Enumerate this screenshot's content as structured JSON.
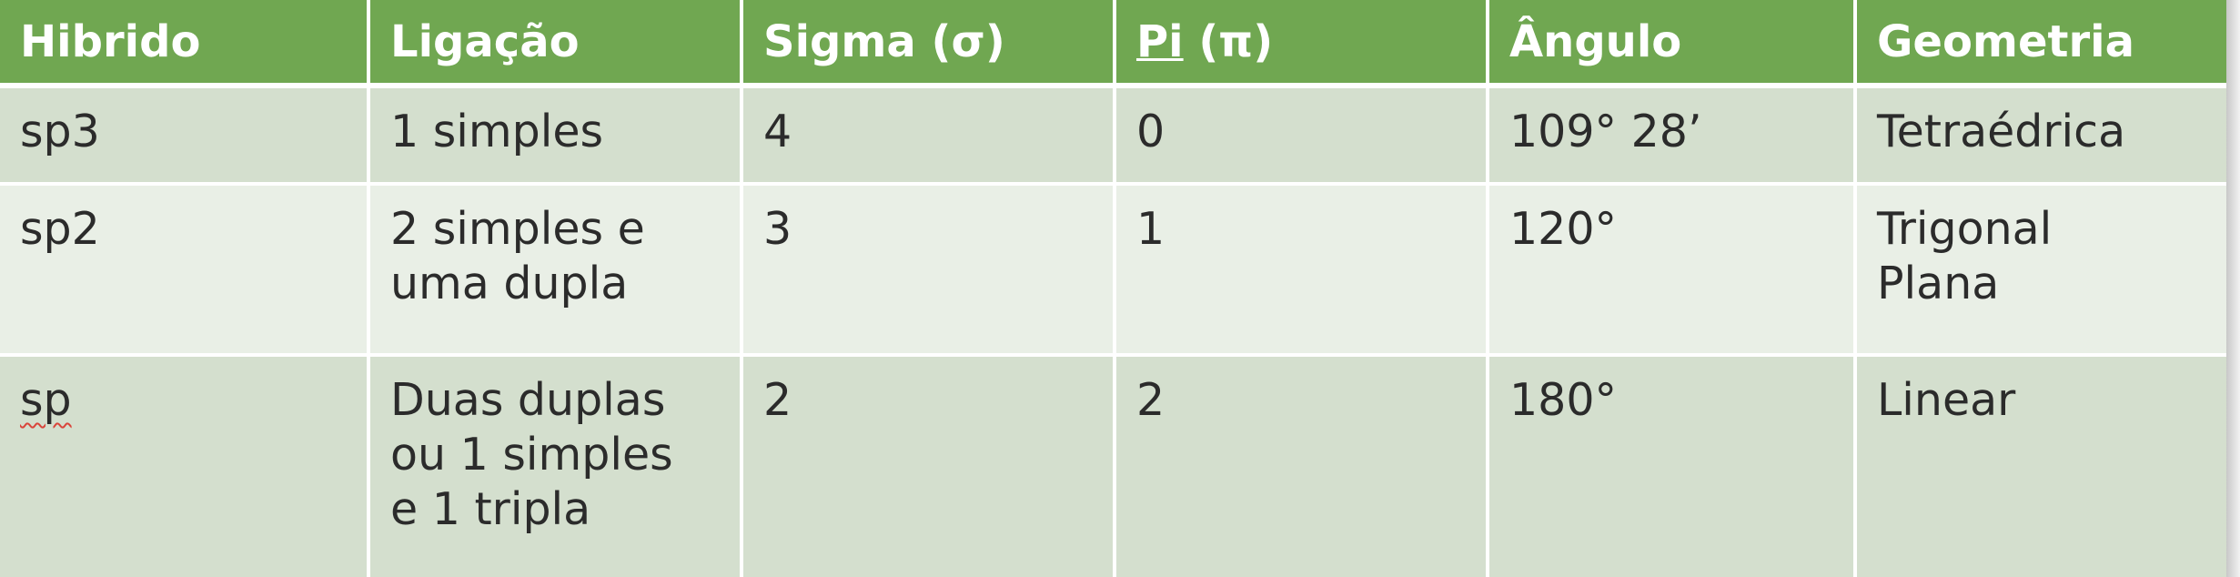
{
  "table": {
    "headers": {
      "hibrido": "Hibrido",
      "ligacao": "Ligação",
      "sigma": "Sigma (σ)",
      "pi_word": "Pi",
      "pi_symbol": " (π)",
      "angulo": "Ângulo",
      "geometria": "Geometria"
    },
    "rows": [
      {
        "hibrido": "sp3",
        "ligacao": [
          "1 simples"
        ],
        "sigma": "4",
        "pi": "0",
        "angulo": "109° 28’",
        "geometria": [
          "Tetraédrica"
        ]
      },
      {
        "hibrido": "sp2",
        "ligacao": [
          "2 simples e",
          "uma dupla"
        ],
        "sigma": "3",
        "pi": "1",
        "angulo": "120°",
        "geometria": [
          "Trigonal",
          "Plana"
        ]
      },
      {
        "hibrido": "sp",
        "ligacao": [
          "Duas duplas",
          "ou 1 simples",
          "e 1 tripla"
        ],
        "sigma": "2",
        "pi": "2",
        "angulo": "180°",
        "geometria": [
          "Linear"
        ]
      }
    ]
  },
  "colors": {
    "header_bg": "#70a751",
    "header_text": "#ffffff",
    "row_dark": "#d4dfce",
    "row_light": "#e9efe6",
    "body_text": "#2b2b2b"
  }
}
